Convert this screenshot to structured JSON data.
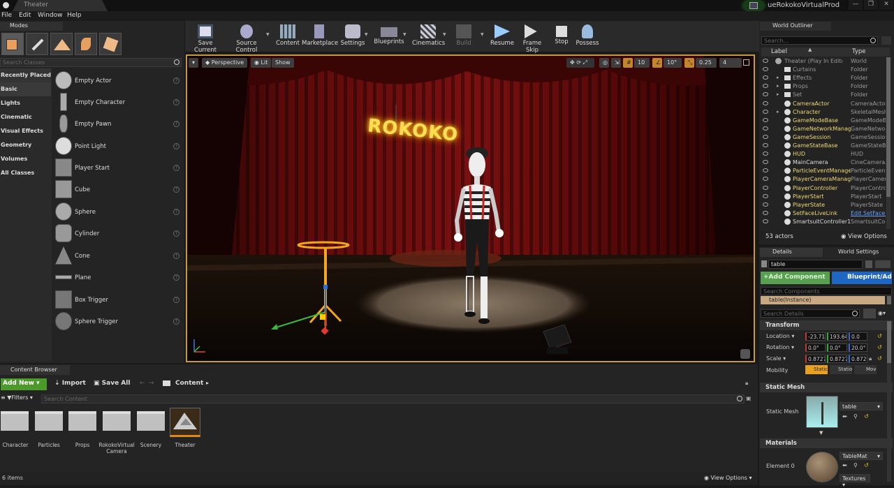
{
  "title_bar": {
    "tab_title": "Theater",
    "project_name": "ueRokokoVirtualProd"
  },
  "menu": [
    "File",
    "Edit",
    "Window",
    "Help"
  ],
  "modes": {
    "tab_label": "Modes",
    "search_placeholder": "Search Classes",
    "categories": [
      "Recently Placed",
      "Basic",
      "Lights",
      "Cinematic",
      "Visual Effects",
      "Geometry",
      "Volumes",
      "All Classes"
    ],
    "items": [
      "Empty Actor",
      "Empty Character",
      "Empty Pawn",
      "Point Light",
      "Player Start",
      "Cube",
      "Sphere",
      "Cylinder",
      "Cone",
      "Plane",
      "Box Trigger",
      "Sphere Trigger"
    ]
  },
  "toolbar": {
    "buttons": [
      "Save Current",
      "Source Control",
      "Content",
      "Marketplace",
      "Settings",
      "Blueprints",
      "Cinematics",
      "Build",
      "Resume",
      "Frame Skip",
      "Stop",
      "Possess"
    ]
  },
  "viewport": {
    "perspective": "Perspective",
    "lit": "Lit",
    "show": "Show",
    "grid_snap": "10",
    "rotation_snap": "10°",
    "scale_snap": "0.25",
    "camera_speed": "4",
    "sign_text": "ROKOKO"
  },
  "world_outliner": {
    "tab_label": "World Outliner",
    "search_placeholder": "Search...",
    "col_label": "Label",
    "col_type": "Type",
    "rows": [
      {
        "label": "Theater (Play In Editor)",
        "type": "World"
      },
      {
        "label": "Curtains",
        "type": "Folder"
      },
      {
        "label": "Effects",
        "type": "Folder"
      },
      {
        "label": "Props",
        "type": "Folder"
      },
      {
        "label": "Set",
        "type": "Folder"
      },
      {
        "label": "CameraActor",
        "type": "CameraActor"
      },
      {
        "label": "Character",
        "type": "SkeletalMesh"
      },
      {
        "label": "GameModeBase",
        "type": "GameModeBase"
      },
      {
        "label": "GameNetworkManager",
        "type": "GameNetworkManager"
      },
      {
        "label": "GameSession",
        "type": "GameSession"
      },
      {
        "label": "GameStateBase",
        "type": "GameStateBase"
      },
      {
        "label": "HUD",
        "type": "HUD"
      },
      {
        "label": "MainCamera",
        "type": "CineCameraActor"
      },
      {
        "label": "ParticleEventManager",
        "type": "ParticleEventManager"
      },
      {
        "label": "PlayerCameraManager",
        "type": "PlayerCameraManager"
      },
      {
        "label": "PlayerController",
        "type": "PlayerController"
      },
      {
        "label": "PlayerStart",
        "type": "PlayerStart"
      },
      {
        "label": "PlayerState",
        "type": "PlayerState"
      },
      {
        "label": "SetFaceLiveLink",
        "type": "Edit SetFaceLiveLink"
      },
      {
        "label": "SmartsuitController1",
        "type": "SmartsuitController"
      }
    ],
    "actor_count": "53 actors",
    "view_options": "View Options"
  },
  "details": {
    "tab_label": "Details",
    "world_settings_label": "World Settings",
    "name_value": "table",
    "add_component": "+Add Component",
    "blueprint_button": "Blueprint/Add Script",
    "search_components_placeholder": "Search Components",
    "instance_label": "table(Instance)",
    "search_details_placeholder": "Search Details",
    "transform_title": "Transform",
    "location_label": "Location",
    "rotation_label": "Rotation",
    "scale_label": "Scale",
    "mobility_label": "Mobility",
    "location": [
      "-23.71",
      "193.64",
      "0.0"
    ],
    "rotation": [
      "0.0°",
      "0.0°",
      "20.0°"
    ],
    "scale": [
      "0.8727",
      "0.8727",
      "0.8727"
    ],
    "mobility": [
      "Static",
      "Stationary",
      "Movable"
    ],
    "static_mesh_title": "Static Mesh",
    "static_mesh_label": "Static Mesh",
    "static_mesh_value": "table",
    "materials_title": "Materials",
    "element_label": "Element 0",
    "material_value": "TableMat",
    "textures_label": "Textures"
  },
  "content_browser": {
    "tab_label": "Content Browser",
    "add_new": "Add New",
    "import": "Import",
    "save_all": "Save All",
    "path": "Content",
    "filters": "Filters",
    "search_placeholder": "Search Content",
    "items": [
      "Character",
      "Particles",
      "Props",
      "RokokoVirtual Camera",
      "Scenery",
      "Theater"
    ],
    "item_count": "6 items",
    "view_options": "View Options"
  },
  "colors": {
    "accent": "#c79b3a",
    "add_new_green": "#4c9a2a",
    "blueprint_blue": "#1d66c4",
    "selection": "#c29a4a"
  }
}
